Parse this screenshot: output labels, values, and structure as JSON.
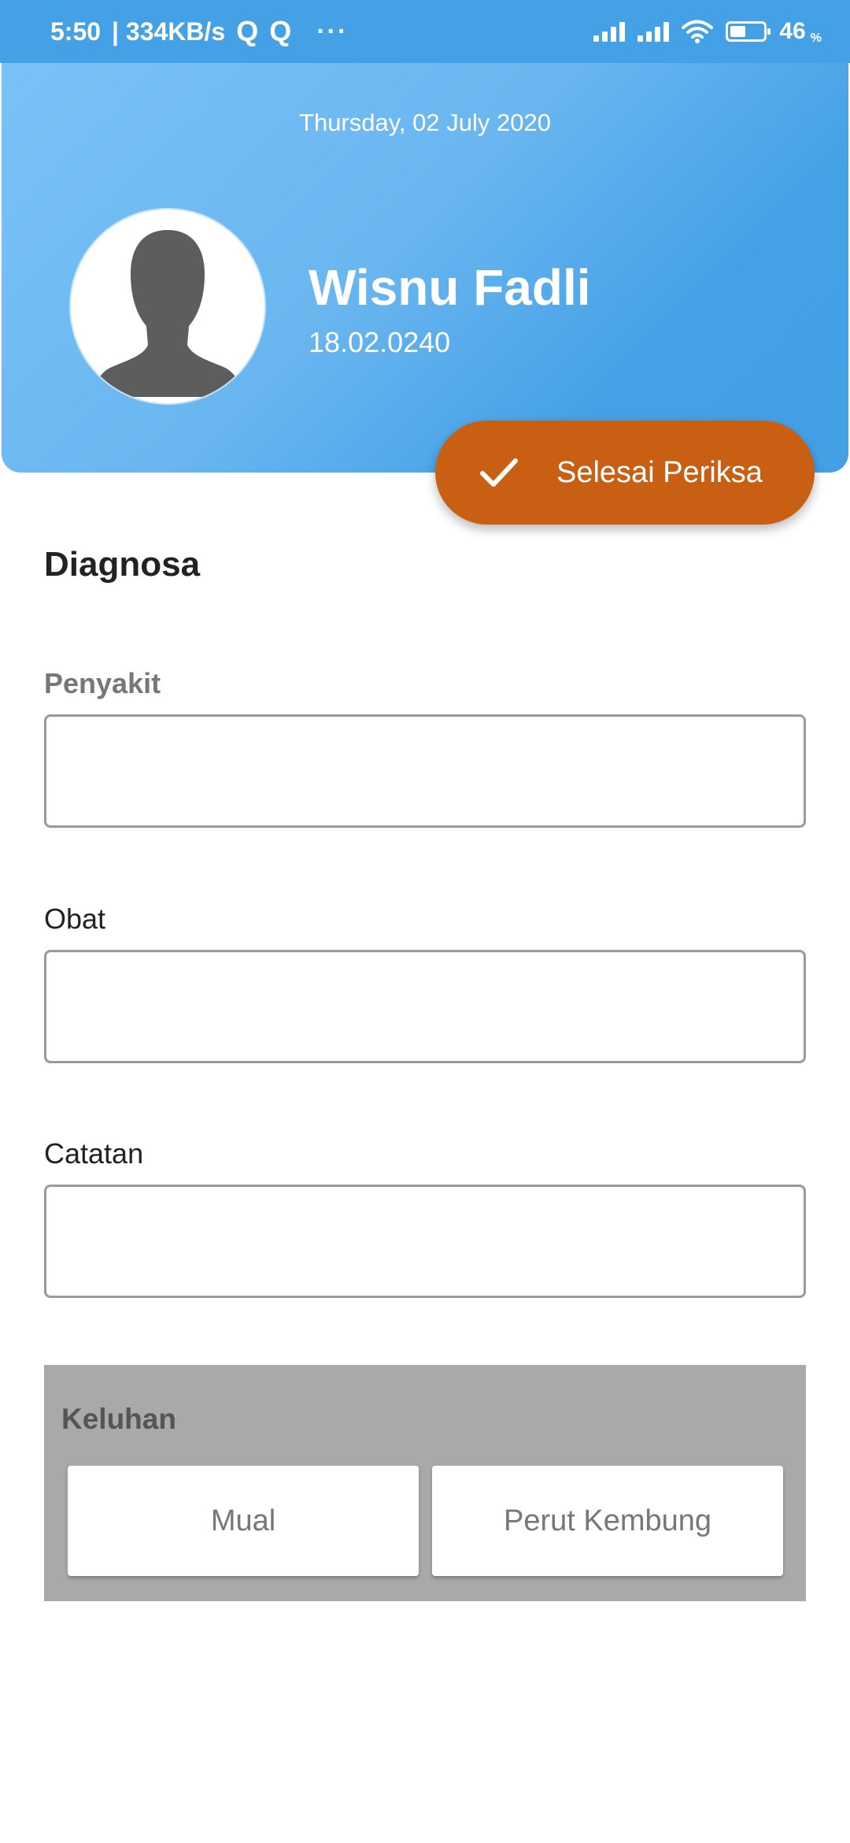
{
  "status_bar": {
    "time": "5:50",
    "speed": "| 334KB/s",
    "app_icon_1": "Q",
    "app_icon_2": "Q",
    "more": "···",
    "battery_percent": "46",
    "battery_sign": "%",
    "battery_level": 0.46
  },
  "header": {
    "date": "Thursday, 02 July 2020",
    "patient_name": "Wisnu Fadli",
    "patient_id": "18.02.0240",
    "avatar_icon": "person-silhouette-icon"
  },
  "fab": {
    "label": "Selesai Periksa",
    "icon": "check-icon",
    "color": "#c95f13"
  },
  "form": {
    "section_title": "Diagnosa",
    "penyakit_label": "Penyakit",
    "penyakit_value": "",
    "obat_label": "Obat",
    "obat_value": "",
    "catatan_label": "Catatan",
    "catatan_value": ""
  },
  "keluhan": {
    "title": "Keluhan",
    "items": [
      "Mual",
      "Perut Kembung"
    ]
  },
  "colors": {
    "accent": "#45a1e6",
    "header_light": "#79c2f8",
    "panel_gray": "#a9a9a9"
  }
}
